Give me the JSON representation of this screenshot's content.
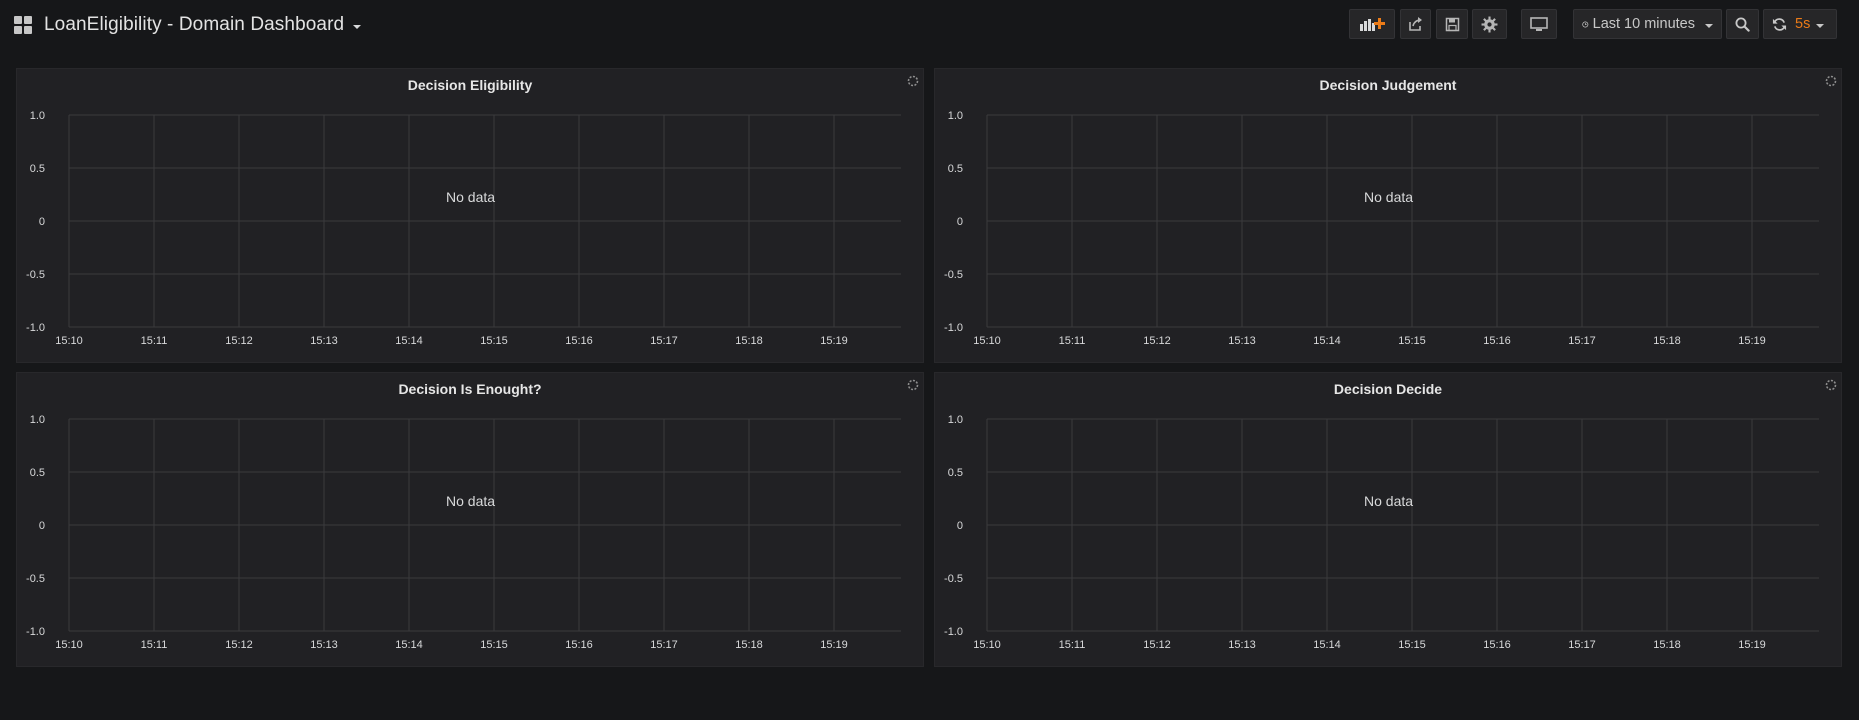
{
  "header": {
    "title": "LoanEligibility - Domain Dashboard",
    "time_range": "Last 10 minutes",
    "refresh_interval": "5s",
    "accent_color": "#eb7b18"
  },
  "icons": {
    "dashboard": "apps-grid-icon",
    "add_panel": "add-panel-icon",
    "share": "share-icon",
    "save": "save-icon",
    "settings": "gear-icon",
    "view_mode": "monitor-icon",
    "clock": "clock-icon",
    "zoom_out": "search-minus-icon",
    "refresh": "refresh-icon",
    "panel_loading": "spinner-icon"
  },
  "panels": [
    {
      "title": "Decision Eligibility",
      "message": "No data",
      "y_ticks": [
        "1.0",
        "0.5",
        "0",
        "-0.5",
        "-1.0"
      ],
      "x_ticks": [
        "15:10",
        "15:11",
        "15:12",
        "15:13",
        "15:14",
        "15:15",
        "15:16",
        "15:17",
        "15:18",
        "15:19"
      ]
    },
    {
      "title": "Decision Judgement",
      "message": "No data",
      "y_ticks": [
        "1.0",
        "0.5",
        "0",
        "-0.5",
        "-1.0"
      ],
      "x_ticks": [
        "15:10",
        "15:11",
        "15:12",
        "15:13",
        "15:14",
        "15:15",
        "15:16",
        "15:17",
        "15:18",
        "15:19"
      ]
    },
    {
      "title": "Decision Is Enought?",
      "message": "No data",
      "y_ticks": [
        "1.0",
        "0.5",
        "0",
        "-0.5",
        "-1.0"
      ],
      "x_ticks": [
        "15:10",
        "15:11",
        "15:12",
        "15:13",
        "15:14",
        "15:15",
        "15:16",
        "15:17",
        "15:18",
        "15:19"
      ]
    },
    {
      "title": "Decision Decide",
      "message": "No data",
      "y_ticks": [
        "1.0",
        "0.5",
        "0",
        "-0.5",
        "-1.0"
      ],
      "x_ticks": [
        "15:10",
        "15:11",
        "15:12",
        "15:13",
        "15:14",
        "15:15",
        "15:16",
        "15:17",
        "15:18",
        "15:19"
      ]
    }
  ]
}
